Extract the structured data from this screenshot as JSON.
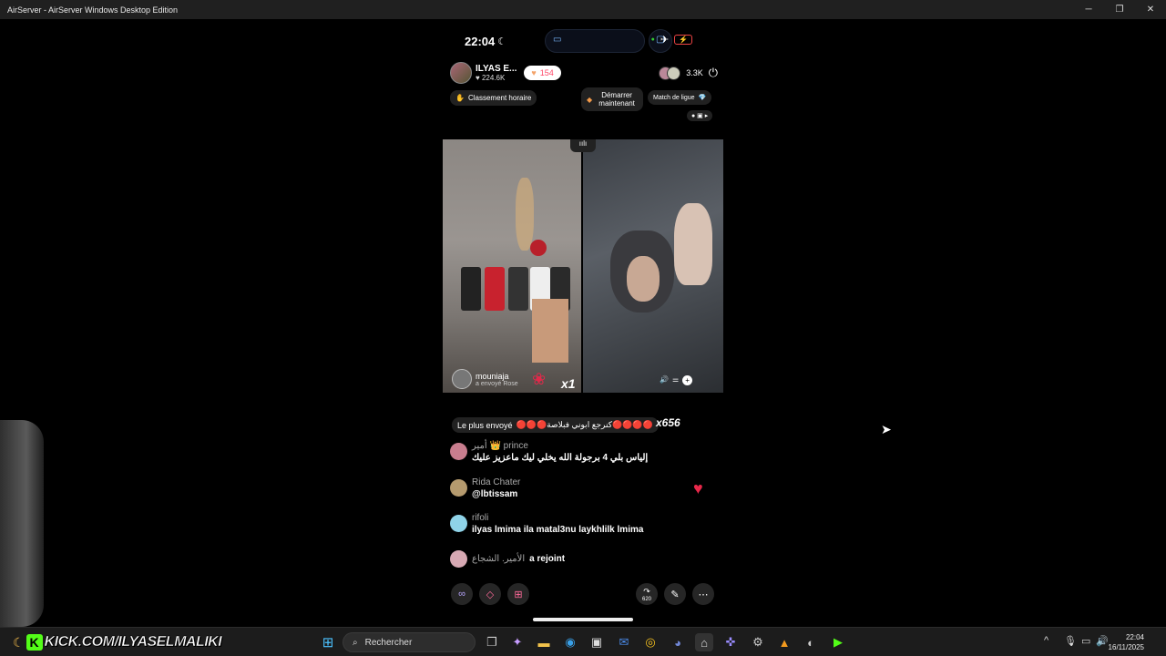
{
  "window": {
    "title": "AirServer - AirServer Windows Desktop Edition",
    "min_icon": "minimize-icon",
    "max_icon": "maximize-icon",
    "close_icon": "close-icon"
  },
  "status_bar": {
    "time": "22:04",
    "moon": "☾"
  },
  "host": {
    "name": "ILYAS E...",
    "likes": "♥ 224.6K",
    "follow_count": "154"
  },
  "viewers": {
    "count": "3.3K"
  },
  "pills": {
    "ranking": "Classement horaire",
    "start": "Démarrer maintenant",
    "league": "Match de ligue"
  },
  "gift_sender": {
    "name": "mouniaja",
    "sent": "a envoyé  Rose",
    "multiplier": "x1"
  },
  "top_sent": {
    "label": "Le plus envoyé",
    "text": "🔴🔴🔴كنرجع ابوني فبلاصة🔴🔴🔴🔴",
    "count": "x656"
  },
  "comments": [
    {
      "user": "أمير 👑 prince",
      "text": "إلياس بلي 4 برجولة الله يخلي ليك ماعزيز عليك",
      "color": "#c87d8e"
    },
    {
      "user": "Rida Chater",
      "text": "@lbtissam",
      "color": "#b59a6e"
    },
    {
      "user": "rifoli",
      "text": "ilyas lmima ila matal3nu laykhlilk lmima",
      "color": "#8fd3e8"
    },
    {
      "user": "الأمير. الشجاع",
      "text": "a rejoint",
      "color": "#d7a9b3"
    }
  ],
  "toolbar": {
    "share_count": "620"
  },
  "taskbar": {
    "kick_letter": "K",
    "kick_url": "KICK.COM/ILYASELMALIKI",
    "search_placeholder": "Rechercher",
    "time": "22:04",
    "date": "16/11/2025"
  },
  "colors": {
    "kick_green": "#53fc18",
    "accent_red": "#e8284a"
  }
}
